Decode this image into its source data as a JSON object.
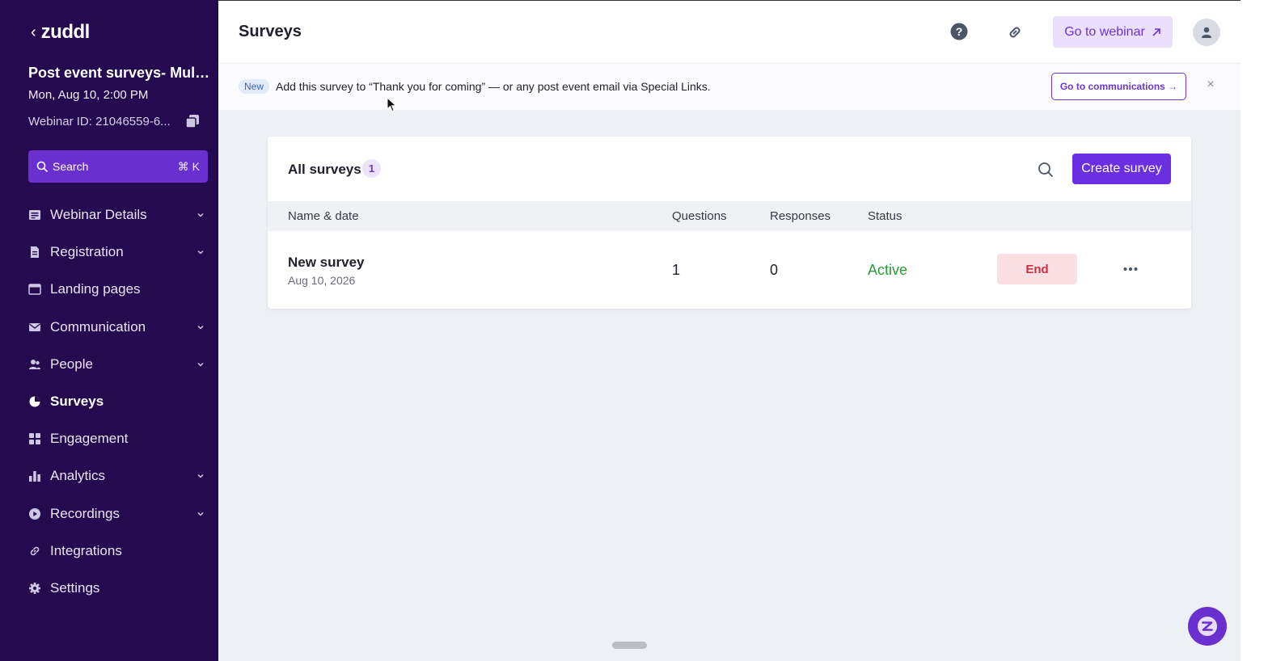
{
  "app": {
    "logo": "zuddl",
    "back_glyph": "‹"
  },
  "event": {
    "title": "Post event surveys- Multi...",
    "date": "Mon, Aug 10, 2:00 PM",
    "webinar_id": "Webinar ID: 21046559-6..."
  },
  "search": {
    "label": "Search",
    "shortcut": "⌘ K"
  },
  "nav": [
    {
      "label": "Webinar Details",
      "icon": "document-list-icon",
      "expandable": true,
      "active": false
    },
    {
      "label": "Registration",
      "icon": "file-text-icon",
      "expandable": true,
      "active": false
    },
    {
      "label": "Landing pages",
      "icon": "browser-window-icon",
      "expandable": false,
      "active": false
    },
    {
      "label": "Communication",
      "icon": "mail-icon",
      "expandable": true,
      "active": false
    },
    {
      "label": "People",
      "icon": "people-icon",
      "expandable": true,
      "active": false
    },
    {
      "label": "Surveys",
      "icon": "pie-chart-icon",
      "expandable": false,
      "active": true
    },
    {
      "label": "Engagement",
      "icon": "grid-icon",
      "expandable": false,
      "active": false
    },
    {
      "label": "Analytics",
      "icon": "bar-chart-icon",
      "expandable": true,
      "active": false
    },
    {
      "label": "Recordings",
      "icon": "play-circle-icon",
      "expandable": true,
      "active": false
    },
    {
      "label": "Integrations",
      "icon": "link-icon",
      "expandable": false,
      "active": false
    },
    {
      "label": "Settings",
      "icon": "gear-icon",
      "expandable": false,
      "active": false
    }
  ],
  "header": {
    "title": "Surveys",
    "go_to_webinar": "Go to webinar"
  },
  "banner": {
    "badge": "New",
    "text": "Add this survey to “Thank you for coming” — or any post event email via Special Links.",
    "cta": "Go to communications →",
    "close": "×"
  },
  "surveys": {
    "title": "All surveys",
    "count": "1",
    "create_label": "Create survey",
    "columns": {
      "name": "Name & date",
      "questions": "Questions",
      "responses": "Responses",
      "status": "Status"
    },
    "rows": [
      {
        "name": "New survey",
        "date": "Aug 10, 2026",
        "questions": "1",
        "responses": "0",
        "status": "Active",
        "action": "End"
      }
    ]
  },
  "colors": {
    "sidebar_bg": "#260a4f",
    "accent": "#6a2fe0",
    "status_active": "#2a9d3a",
    "end_text": "#c93042",
    "end_bg": "#fbe0e3",
    "main_bg": "#edf1f5"
  }
}
